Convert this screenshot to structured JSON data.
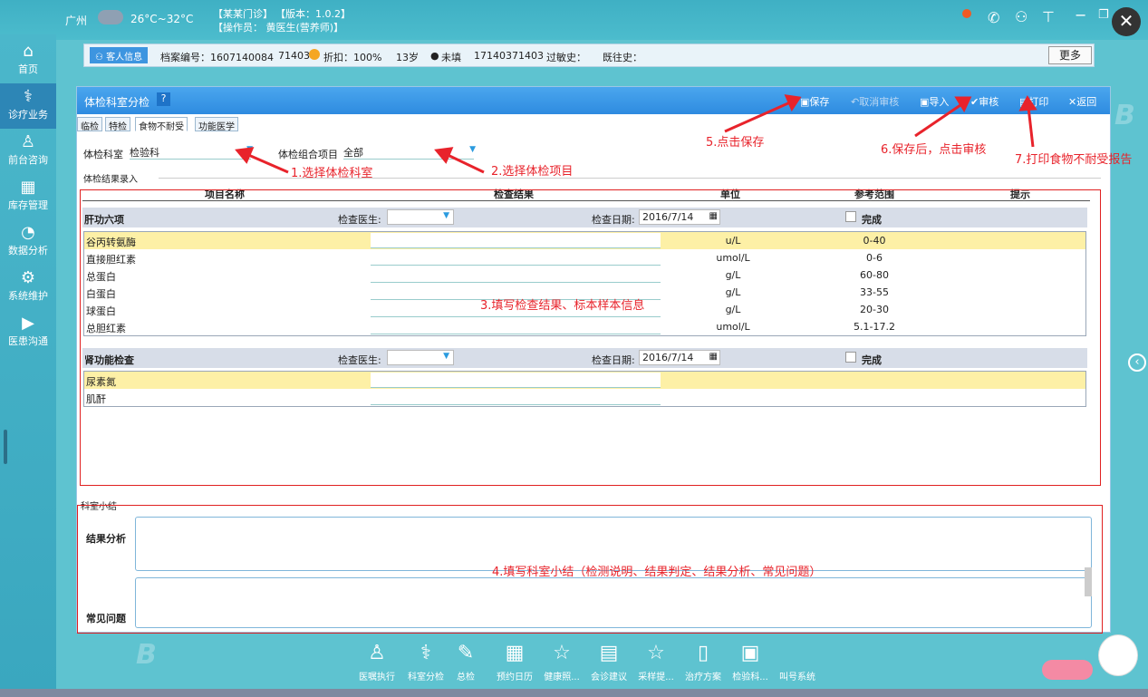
{
  "header": {
    "city": "广州",
    "temp": "26°C~32°C",
    "clinic": "【某某门诊】",
    "version": "【版本：1.0.2】",
    "operator": "【操作员： 黄医生(营养师)】"
  },
  "sidebar": {
    "items": [
      {
        "label": "首页",
        "icon": "home-icon"
      },
      {
        "label": "诊疗业务",
        "icon": "doctor-icon"
      },
      {
        "label": "前台咨询",
        "icon": "reception-icon"
      },
      {
        "label": "库存管理",
        "icon": "inventory-icon"
      },
      {
        "label": "数据分析",
        "icon": "analysis-icon"
      },
      {
        "label": "系统维护",
        "icon": "settings-icon"
      },
      {
        "label": "医患沟通",
        "icon": "video-icon"
      }
    ]
  },
  "info": {
    "guest_btn": "客人信息",
    "file_no": "档案编号：1607140084",
    "id2": "71403",
    "discount": "折扣：100%",
    "age": "13岁",
    "status": "未填",
    "phone": "17140371403",
    "allergy": "过敏史：",
    "history": "既往史：",
    "more": "更多"
  },
  "panel": {
    "title": "体检科室分检",
    "help": "?",
    "toolbar": {
      "save": "保存",
      "cancel_audit": "取消审核",
      "import": "导入",
      "audit": "审核",
      "print": "打印",
      "back": "返回"
    },
    "tabs": [
      "临检",
      "特检",
      "食物不耐受",
      "功能医学"
    ],
    "dept_label": "体检科室",
    "dept_value": "检验科",
    "combo_label": "体检组合项目",
    "combo_value": "全部",
    "section_label": "体检结果录入",
    "columns": [
      "项目名称",
      "检查结果",
      "单位",
      "参考范围",
      "提示"
    ],
    "groups": [
      {
        "name": "肝功六项",
        "doctor_label": "检查医生:",
        "date_label": "检查日期:",
        "date": "2016/7/14",
        "done_label": "完成",
        "rows": [
          {
            "name": "谷丙转氨酶",
            "unit": "u/L",
            "range": "0-40"
          },
          {
            "name": "直接胆红素",
            "unit": "umol/L",
            "range": "0-6"
          },
          {
            "name": "总蛋白",
            "unit": "g/L",
            "range": "60-80"
          },
          {
            "name": "白蛋白",
            "unit": "g/L",
            "range": "33-55"
          },
          {
            "name": "球蛋白",
            "unit": "g/L",
            "range": "20-30"
          },
          {
            "name": "总胆红素",
            "unit": "umol/L",
            "range": "5.1-17.2"
          }
        ]
      },
      {
        "name": "肾功能检查",
        "doctor_label": "检查医生:",
        "date_label": "检查日期:",
        "date": "2016/7/14",
        "done_label": "完成",
        "rows": [
          {
            "name": "尿素氮",
            "unit": "",
            "range": ""
          },
          {
            "name": "肌酐",
            "unit": "",
            "range": ""
          }
        ]
      }
    ],
    "summary_label": "科室小结",
    "analysis_label": "结果分析",
    "problems_label": "常见问题"
  },
  "annotations": {
    "a1": "1.选择体检科室",
    "a2": "2.选择体检项目",
    "a3": "3.填写检查结果、标本样本信息",
    "a4": "4.填写科室小结（检测说明、结果判定、结果分析、常见问题）",
    "a5": "5.点击保存",
    "a6": "6.保存后，点击审核",
    "a7": "7.打印食物不耐受报告"
  },
  "dock": [
    "医嘱执行",
    "科室分检",
    "总检",
    "预约日历",
    "健康照...",
    "会诊建议",
    "采样提...",
    "治疗方案",
    "检验科...",
    "叫号系统"
  ],
  "colors": {
    "accent": "#2e8be0",
    "annotation": "#e8232b",
    "highlight": "#fdf0a6"
  }
}
